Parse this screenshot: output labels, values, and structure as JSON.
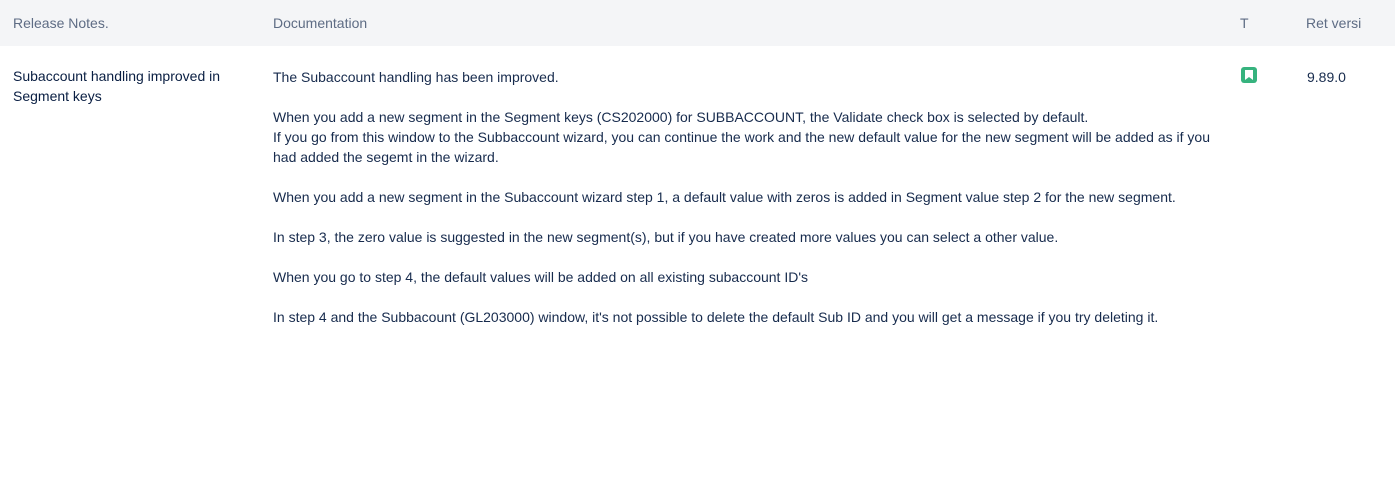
{
  "headers": {
    "release_notes": "Release Notes.",
    "documentation": "Documentation",
    "type": "T",
    "version": "Ret versi"
  },
  "row": {
    "title": "Subaccount handling improved in Segment keys",
    "type_icon": "bookmark-icon",
    "type_color": "#36b37e",
    "version": "9.89.0",
    "doc": {
      "p1": "The Subaccount handling has been improved.",
      "p2a": "When you add a new segment in the Segment keys (CS202000) for SUBBACCOUNT, the Validate check box is selected by default.",
      "p2b": "If you go from this window to the Subbaccount wizard, you can continue the work and the new default value for the new segment will be added as if you had added the segemt in the wizard.",
      "p3": "When you add a new segment in the Subaccount wizard step 1, a default value with zeros is added in Segment value step 2 for the new segment.",
      "p4": "In step 3, the zero value is suggested in the new segment(s), but if you have created more values you can select a other value.",
      "p5": "When you go to step 4, the default values will be added on all existing subaccount ID's",
      "p6": "In step 4 and the Subbacount (GL203000) window, it's not possible to delete the default Sub ID and you will get a message if you try deleting it."
    }
  }
}
